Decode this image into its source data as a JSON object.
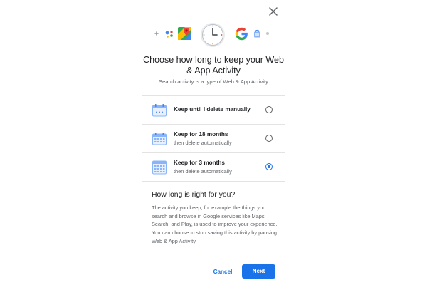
{
  "dialog": {
    "title": "Choose how long to keep your Web & App Activity",
    "subtitle": "Search activity is a type of Web & App Activity",
    "options": [
      {
        "title": "Keep until I delete manually",
        "subtitle": "",
        "selected": false,
        "icon": "calendar-infinite-icon"
      },
      {
        "title": "Keep for 18 months",
        "subtitle": "then delete automatically",
        "selected": false,
        "icon": "calendar-18-months-icon"
      },
      {
        "title": "Keep for 3 months",
        "subtitle": "then delete automatically",
        "selected": true,
        "icon": "calendar-3-months-icon"
      }
    ],
    "help": {
      "heading": "How long is right for you?",
      "body": "The activity you keep, for example the things you search and browse in Google services like Maps, Search, and Play, is used to improve your experience. You can choose to stop saving this activity by pausing Web & App Activity."
    },
    "buttons": {
      "cancel": "Cancel",
      "next": "Next"
    }
  },
  "header_icons": [
    "sparkle-icon",
    "assistant-icon",
    "maps-icon",
    "clock-icon",
    "google-icon",
    "shopping-icon",
    "dot-icon"
  ],
  "colors": {
    "accent": "#1a73e8",
    "text": "#202124",
    "secondary_text": "#5f6368",
    "divider": "#e3e3e3"
  }
}
